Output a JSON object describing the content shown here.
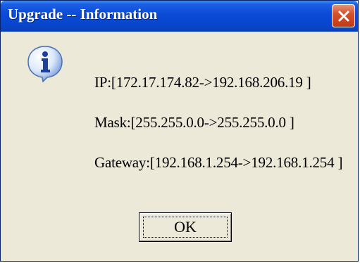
{
  "window": {
    "title": "Upgrade -- Information"
  },
  "icons": {
    "close": "close-icon",
    "info": "info-icon"
  },
  "messages": {
    "ip": "IP:[172.17.174.82->192.168.206.19 ]",
    "mask": "Mask:[255.255.0.0->255.255.0.0 ]",
    "gateway": "Gateway:[192.168.1.254->192.168.1.254 ]"
  },
  "buttons": {
    "ok": "OK"
  },
  "colors": {
    "titlebar": "#0a4ad6",
    "close_button": "#c23a16",
    "dialog_background": "#ece9d8"
  }
}
